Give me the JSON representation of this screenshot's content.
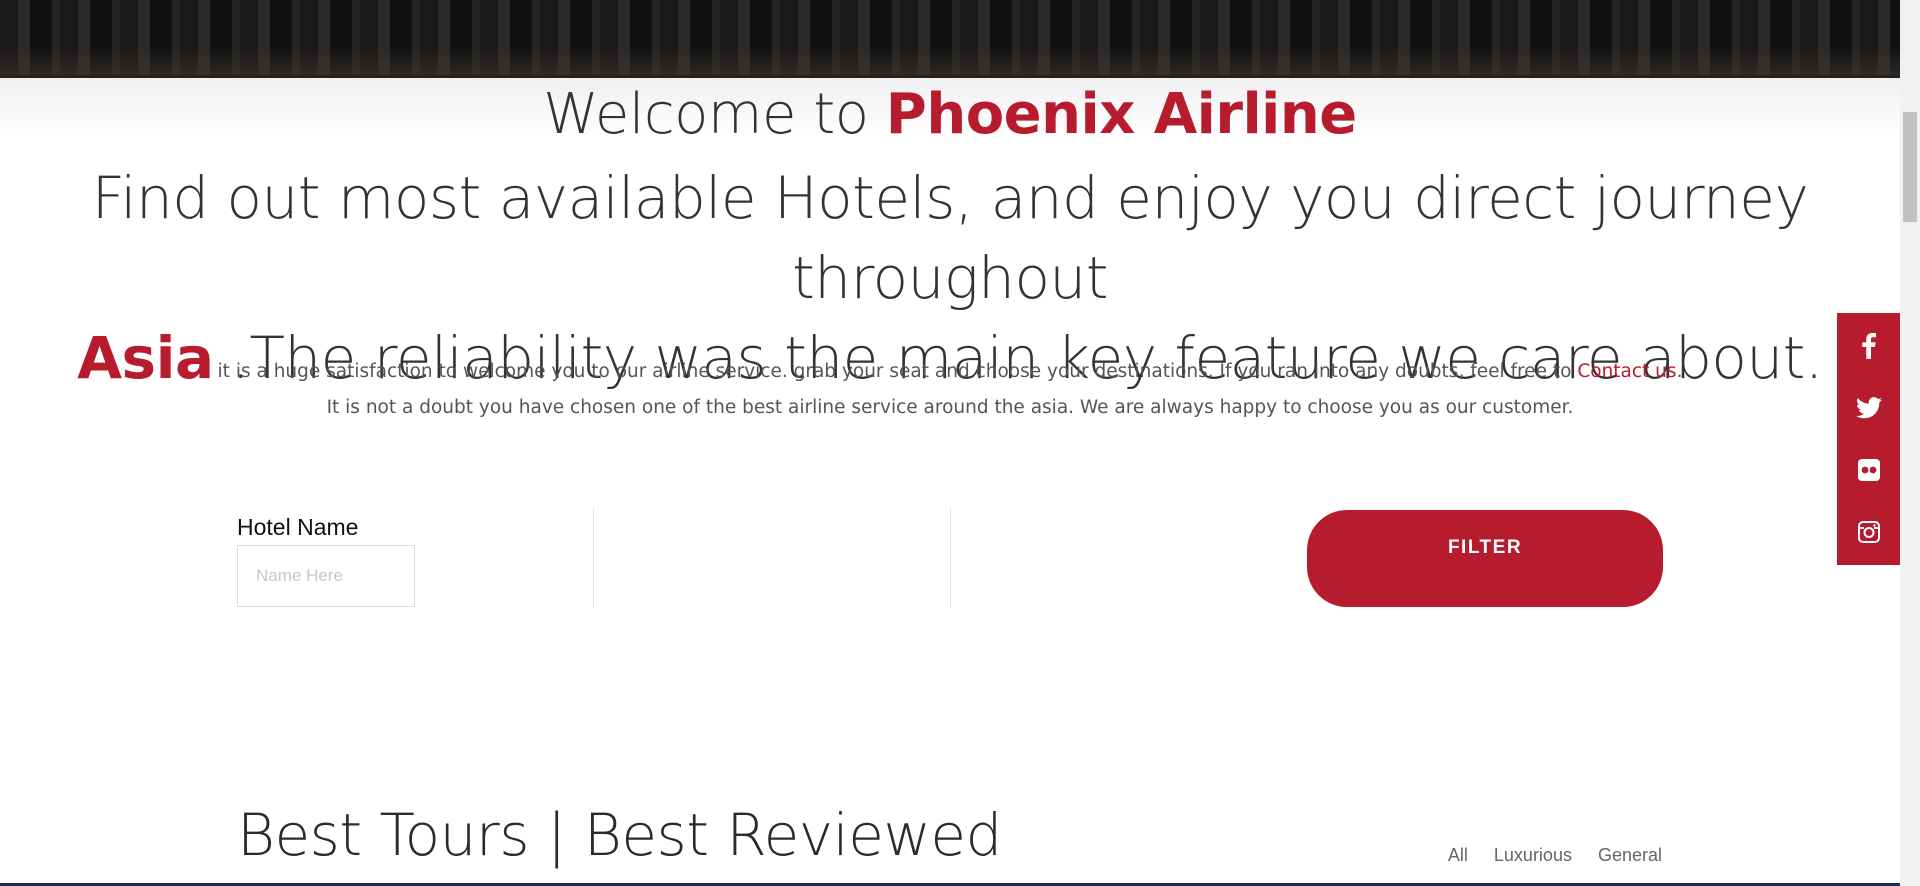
{
  "headline": {
    "welcome_prefix": "Welcome to",
    "brand": "Phoenix Airline",
    "tagline_part1": "Find out most available Hotels, and enjoy you direct journey throughout",
    "region": "Asia",
    "tagline_part2": ".The reliability was the main key feature we care about."
  },
  "intro": {
    "line1": "it is a huge satisfaction to welcome you to our airline service. grab your seat and choose your destinations. If you ran into any doubts, feel free to",
    "contact_link": "Contact us",
    "line1_end": ".",
    "line2": "It is not a doubt you have chosen one of the best airline service around the asia. We are always happy to choose you as our customer."
  },
  "filter": {
    "hotel_label": "Hotel Name",
    "hotel_placeholder": "Name Here",
    "hotel_value": "",
    "button_label": "FILTER"
  },
  "tours": {
    "title": "Best Tours | Best Reviewed",
    "tabs": [
      "All",
      "Luxurious",
      "General"
    ]
  },
  "social": {
    "icons": [
      "facebook-icon",
      "twitter-icon",
      "flickr-icon",
      "instagram-icon"
    ]
  },
  "colors": {
    "accent": "#b71c2e",
    "text": "#333333",
    "muted": "#555555"
  }
}
